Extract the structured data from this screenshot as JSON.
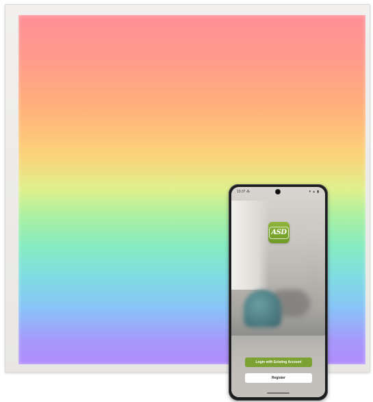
{
  "phone": {
    "status_bar": {
      "time": "13:37",
      "left_icon": "notification-icon",
      "right_icons": "▾ ▴ ▮"
    },
    "app": {
      "logo_text": "ASD",
      "brand_color": "#7ca233"
    },
    "buttons": {
      "login_label": "Login with Existing Account",
      "register_label": "Register"
    }
  },
  "colors": {
    "panel_frame": "#eceae7",
    "panel_top": "#ff8f96",
    "panel_middle": "#dff08d",
    "panel_bottom": "#b08cfb"
  }
}
